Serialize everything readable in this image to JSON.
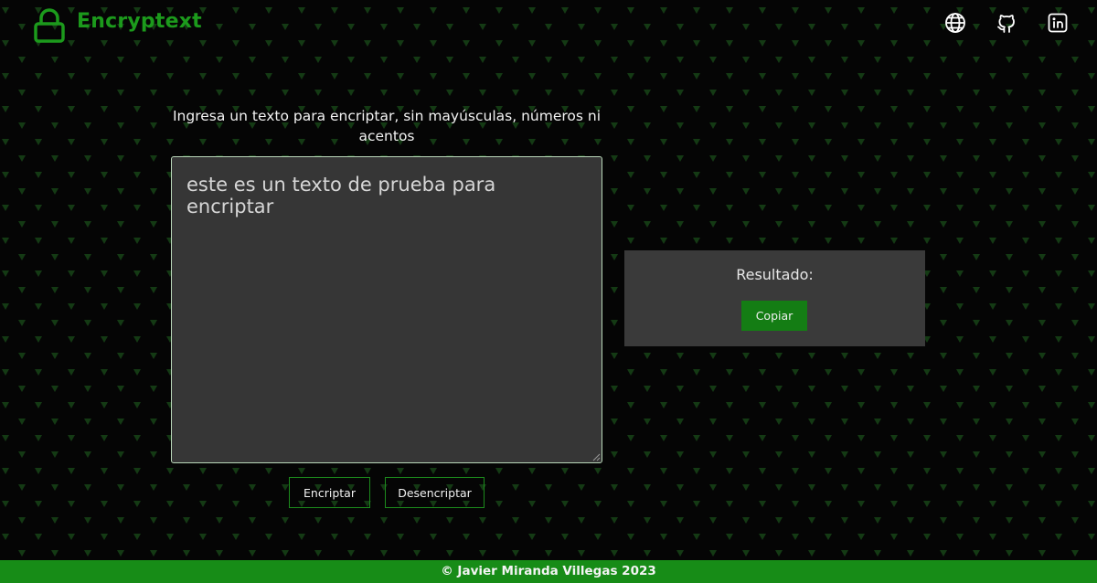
{
  "colors": {
    "accent": "#178c17",
    "background": "#050505",
    "panel": "#3a3a3a",
    "textarea_bg": "#363636"
  },
  "header": {
    "app_name": "Encryptext",
    "logo_icon": "lock-icon",
    "links": [
      {
        "icon": "globe-icon"
      },
      {
        "icon": "github-icon"
      },
      {
        "icon": "linkedin-icon"
      }
    ]
  },
  "main": {
    "instruction": "Ingresa un texto para encriptar, sin mayúsculas, números ni acentos",
    "input_value": "este es un texto de prueba para encriptar",
    "encrypt_label": "Encriptar",
    "decrypt_label": "Desencriptar"
  },
  "result": {
    "title": "Resultado:",
    "copy_label": "Copiar"
  },
  "footer": {
    "text": "© Javier Miranda Villegas 2023"
  }
}
